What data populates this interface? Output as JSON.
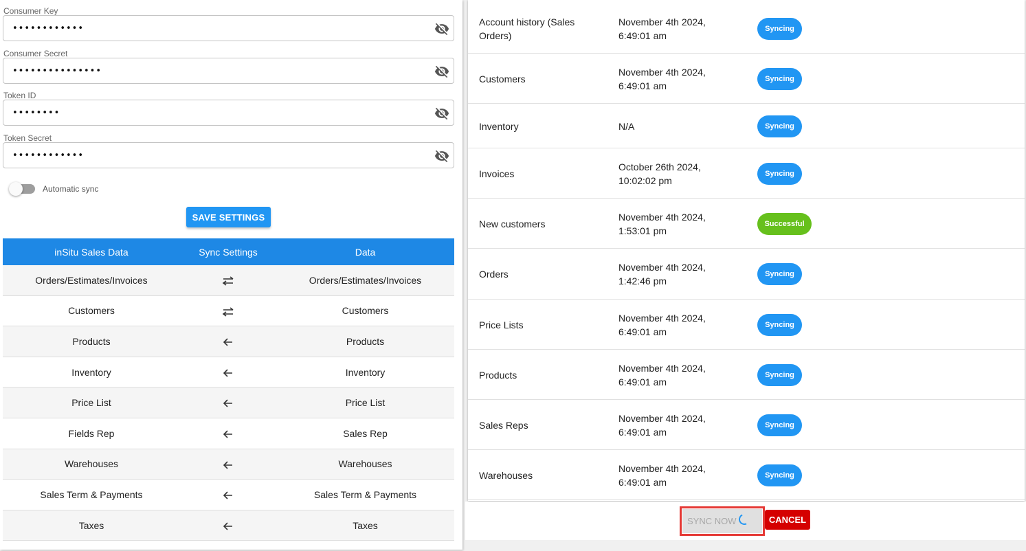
{
  "credentials": [
    {
      "label": "Consumer Key",
      "value": "••••••••••••",
      "icon": "eye-off-icon"
    },
    {
      "label": "Consumer Secret",
      "value": "•••••••••••••••",
      "icon": "eye-off-icon"
    },
    {
      "label": "Token ID",
      "value": "••••••••",
      "icon": "eye-off-icon"
    },
    {
      "label": "Token Secret",
      "value": "••••••••••••",
      "icon": "eye-off-icon"
    }
  ],
  "auto_sync": {
    "label": "Automatic sync",
    "enabled": false
  },
  "save_button": "SAVE SETTINGS",
  "mapping": {
    "headers": [
      "inSitu Sales Data",
      "Sync Settings",
      "Data"
    ],
    "rows": [
      {
        "left": "Orders/Estimates/Invoices",
        "direction": "bidirectional",
        "right": "Orders/Estimates/Invoices"
      },
      {
        "left": "Customers",
        "direction": "bidirectional",
        "right": "Customers"
      },
      {
        "left": "Products",
        "direction": "left",
        "right": "Products"
      },
      {
        "left": "Inventory",
        "direction": "left",
        "right": "Inventory"
      },
      {
        "left": "Price List",
        "direction": "left",
        "right": "Price List"
      },
      {
        "left": "Fields Rep",
        "direction": "left",
        "right": "Sales Rep"
      },
      {
        "left": "Warehouses",
        "direction": "left",
        "right": "Warehouses"
      },
      {
        "left": "Sales Term & Payments",
        "direction": "left",
        "right": "Sales Term & Payments"
      },
      {
        "left": "Taxes",
        "direction": "left",
        "right": "Taxes"
      }
    ]
  },
  "status_list": [
    {
      "name": "Account history (Sales Orders)",
      "date": "November 4th 2024, 6:49:01 am",
      "status": "Syncing"
    },
    {
      "name": "Customers",
      "date": "November 4th 2024, 6:49:01 am",
      "status": "Syncing"
    },
    {
      "name": "Inventory",
      "date": "N/A",
      "status": "Syncing"
    },
    {
      "name": "Invoices",
      "date": "October 26th 2024, 10:02:02 pm",
      "status": "Syncing"
    },
    {
      "name": "New customers",
      "date": "November 4th 2024, 1:53:01 pm",
      "status": "Successful"
    },
    {
      "name": "Orders",
      "date": "November 4th 2024, 1:42:46 pm",
      "status": "Syncing"
    },
    {
      "name": "Price Lists",
      "date": "November 4th 2024, 6:49:01 am",
      "status": "Syncing"
    },
    {
      "name": "Products",
      "date": "November 4th 2024, 6:49:01 am",
      "status": "Syncing"
    },
    {
      "name": "Sales Reps",
      "date": "November 4th 2024, 6:49:01 am",
      "status": "Syncing"
    },
    {
      "name": "Warehouses",
      "date": "November 4th 2024, 6:49:01 am",
      "status": "Syncing"
    }
  ],
  "footer": {
    "sync_now": "SYNC NOW",
    "cancel": "CANCEL"
  },
  "colors": {
    "primary": "#2196f3",
    "header_blue": "#1e88e5",
    "success": "#66c01c",
    "danger": "#d50000",
    "highlight_border": "#e53935"
  }
}
